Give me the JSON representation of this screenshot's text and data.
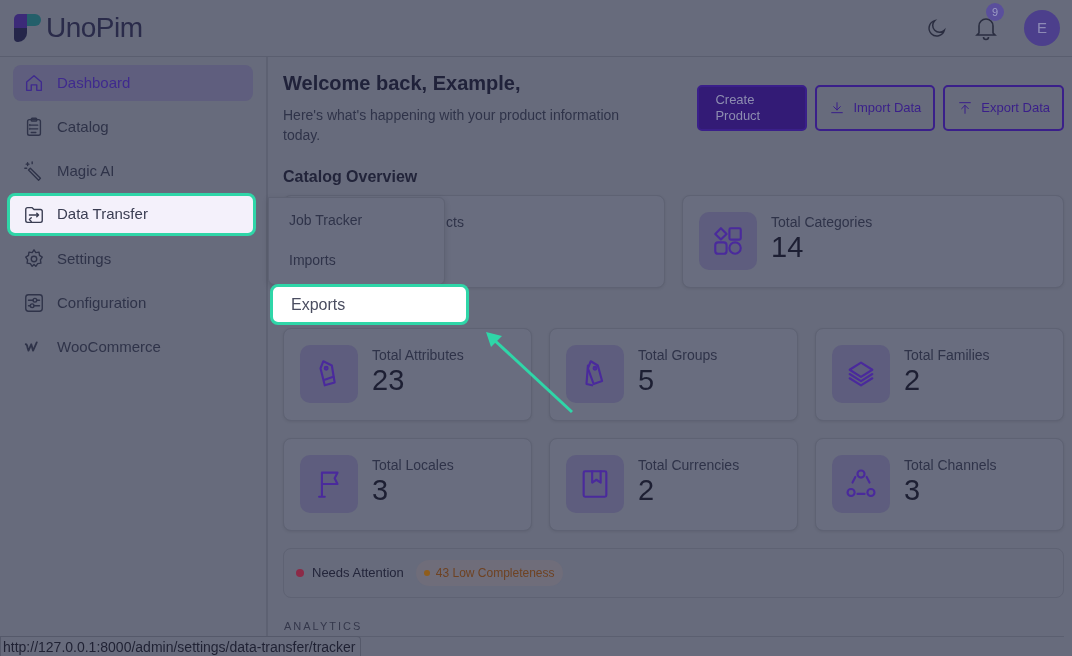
{
  "header": {
    "logo": "UnoPim",
    "notification_count": "9",
    "avatar": "E"
  },
  "sidebar": {
    "items": [
      {
        "label": "Dashboard",
        "kind": "home",
        "selected": true,
        "highlighted": false
      },
      {
        "label": "Catalog",
        "kind": "clipboard",
        "selected": false,
        "highlighted": false
      },
      {
        "label": "Magic AI",
        "kind": "wand",
        "selected": false,
        "highlighted": false
      },
      {
        "label": "Data Transfer",
        "kind": "transfer",
        "selected": false,
        "highlighted": true
      },
      {
        "label": "Settings",
        "kind": "gear",
        "selected": false,
        "highlighted": false
      },
      {
        "label": "Configuration",
        "kind": "sliders",
        "selected": false,
        "highlighted": false
      },
      {
        "label": "WooCommerce",
        "kind": "woo",
        "selected": false,
        "highlighted": false
      }
    ]
  },
  "submenu": {
    "items": [
      {
        "label": "Job Tracker",
        "highlighted": false
      },
      {
        "label": "Imports",
        "highlighted": false
      },
      {
        "label": "Exports",
        "highlighted": true
      }
    ]
  },
  "page": {
    "title": "Welcome back, Example,",
    "subtitle": "Here's what's happening with your product information today.",
    "buttons": [
      {
        "label": "Create Product",
        "kind": "primary"
      },
      {
        "label": "Import Data",
        "kind": "import"
      },
      {
        "label": "Export Data",
        "kind": "export"
      }
    ]
  },
  "catalog_overview": {
    "title": "Catalog Overview",
    "cards": [
      {
        "label": "cts",
        "kind": "covered"
      },
      {
        "label": "Total Categories",
        "value": "14",
        "kind": "shapes"
      }
    ]
  },
  "stats": [
    {
      "label": "Total Attributes",
      "value": "23",
      "kind": "tag"
    },
    {
      "label": "Total Groups",
      "value": "5",
      "kind": "tags"
    },
    {
      "label": "Total Families",
      "value": "2",
      "kind": "layers"
    },
    {
      "label": "Total Locales",
      "value": "3",
      "kind": "flag"
    },
    {
      "label": "Total Currencies",
      "value": "2",
      "kind": "bookmark"
    },
    {
      "label": "Total Channels",
      "value": "3",
      "kind": "nodes"
    }
  ],
  "alerts": {
    "label": "Needs Attention",
    "color": "#8c2a47",
    "chips": [
      {
        "label": "43 Low Completeness",
        "color": "#8f5d1c"
      }
    ]
  },
  "analytics": {
    "title": "ANALYTICS"
  },
  "status_bar": {
    "url": "http://127.0.0.1:8000/admin/settings/data-transfer/tracker"
  }
}
